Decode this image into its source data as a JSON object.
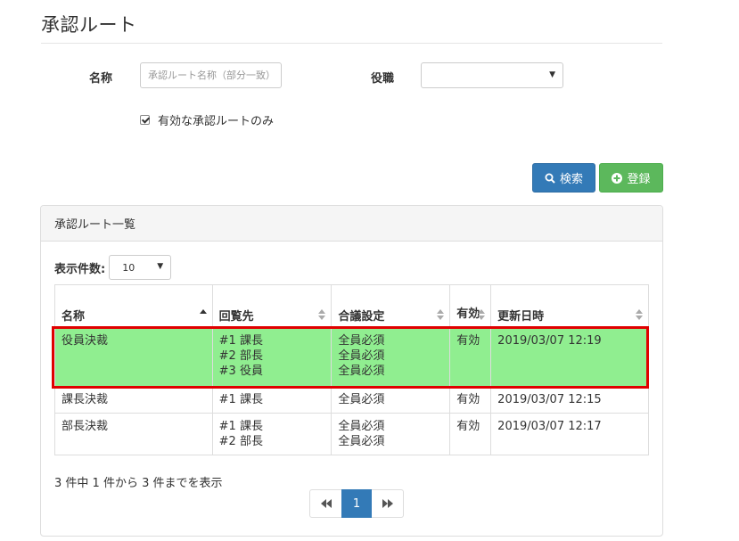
{
  "page": {
    "title": "承認ルート"
  },
  "search": {
    "name_label": "名称",
    "name_placeholder": "承認ルート名称（部分一致）",
    "name_value": "",
    "role_label": "役職",
    "role_selected": "",
    "active_only_label": "有効な承認ルートのみ",
    "active_only_checked": true,
    "search_button": "検索",
    "add_button": "登録"
  },
  "panel": {
    "title": "承認ルート一覧",
    "length_label": "表示件数:",
    "length_value": "10",
    "columns": [
      "名称",
      "回覧先",
      "合議設定",
      "有効",
      "更新日時"
    ],
    "rows": [
      {
        "name": "役員決裁",
        "targets": [
          "#1 課長",
          "#2 部長",
          "#3 役員"
        ],
        "consensus": [
          "全員必須",
          "全員必須",
          "全員必須"
        ],
        "active": "有効",
        "updated": "2019/03/07 12:19",
        "highlighted": true
      },
      {
        "name": "課長決裁",
        "targets": [
          "#1 課長"
        ],
        "consensus": [
          "全員必須"
        ],
        "active": "有効",
        "updated": "2019/03/07 12:15",
        "highlighted": false
      },
      {
        "name": "部長決裁",
        "targets": [
          "#1 課長",
          "#2 部長"
        ],
        "consensus": [
          "全員必須",
          "全員必須"
        ],
        "active": "有効",
        "updated": "2019/03/07 12:17",
        "highlighted": false
      }
    ],
    "info": "3 件中 1 件から 3 件までを表示",
    "pagination": {
      "current_page": "1"
    }
  },
  "colors": {
    "primary": "#337ab7",
    "success": "#5cb85c",
    "highlight_row": "#90ee90",
    "highlight_border": "#e00000"
  }
}
